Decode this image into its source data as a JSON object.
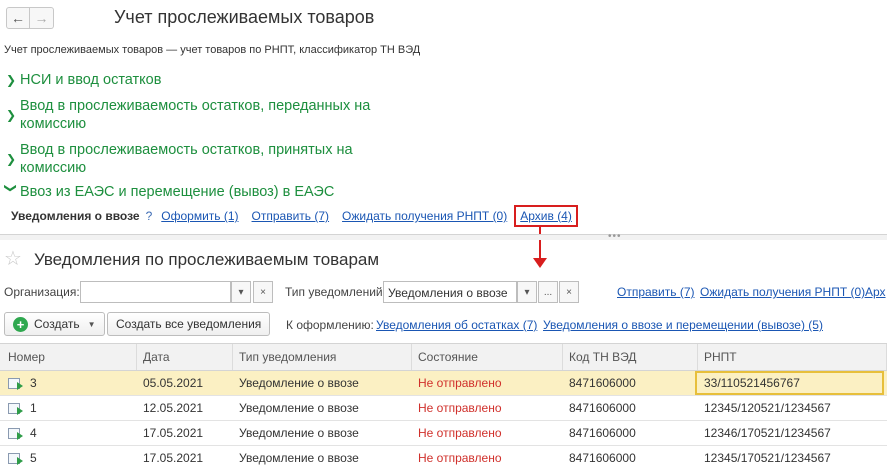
{
  "window": {
    "title": "Учет прослеживаемых товаров",
    "subtitle": "Учет прослеживаемых товаров — учет товаров по РНПТ, классификатор ТН ВЭД",
    "back_icon": "arrow-left-icon",
    "forward_icon": "arrow-right-icon"
  },
  "sections": [
    {
      "label": "НСИ и ввод остатков",
      "expanded": false
    },
    {
      "label": "Ввод в прослеживаемость остатков, переданных на комиссию",
      "expanded": false
    },
    {
      "label": "Ввод в прослеживаемость остатков, принятых на комиссию",
      "expanded": false
    },
    {
      "label": "Ввоз из ЕАЭС и перемещение (вывоз) в ЕАЭС",
      "expanded": true
    }
  ],
  "notice_links": {
    "label": "Уведомления о ввозе",
    "help": "?",
    "oformit": "Оформить (1)",
    "otpravit": "Отправить (7)",
    "ozhidat": "Ожидать получения РНПТ (0)",
    "arkhiv": "Архив (4)"
  },
  "form": {
    "title": "Уведомления по прослеживаемым товарам",
    "favorite_icon": "star-icon"
  },
  "filters": {
    "org_label": "Организация:",
    "org_value": "",
    "type_label": "Тип уведомлений:",
    "type_value": "Уведомления о ввозе",
    "dropdown_glyph": "▾",
    "select_glyph": "...",
    "clear_glyph": "×",
    "link_otpravit": "Отправить (7)",
    "link_ozhidat": "Ожидать получения РНПТ (0)",
    "link_arkh": "Арх"
  },
  "actions": {
    "create_label": "Создать",
    "create_all_label": "Создать все уведомления",
    "to_process_label": "К оформлению:",
    "link_ostatki": "Уведомления об остатках (7)",
    "link_vvoz": "Уведомления о ввозе и перемещении (вывозе) (5)"
  },
  "table": {
    "headers": [
      "Номер",
      "Дата",
      "Тип уведомления",
      "Состояние",
      "Код ТН ВЭД",
      "РНПТ"
    ],
    "rows": [
      {
        "number": "3",
        "date": "05.05.2021",
        "type": "Уведомление о ввозе",
        "status": "Не отправлено",
        "code": "8471606000",
        "rnpt": "33/110521456767",
        "selected": true
      },
      {
        "number": "1",
        "date": "12.05.2021",
        "type": "Уведомление о ввозе",
        "status": "Не отправлено",
        "code": "8471606000",
        "rnpt": "12345/120521/1234567",
        "selected": false
      },
      {
        "number": "4",
        "date": "17.05.2021",
        "type": "Уведомление о ввозе",
        "status": "Не отправлено",
        "code": "8471606000",
        "rnpt": "12346/170521/1234567",
        "selected": false
      },
      {
        "number": "5",
        "date": "17.05.2021",
        "type": "Уведомление о ввозе",
        "status": "Не отправлено",
        "code": "8471606000",
        "rnpt": "12345/170521/1234567",
        "selected": false
      }
    ]
  },
  "colors": {
    "section_green": "#1d8f3e",
    "link_blue": "#1a56b3",
    "highlight_red": "#d81e1e",
    "status_red": "#d0302b",
    "selected_row": "#fbf0c3"
  }
}
